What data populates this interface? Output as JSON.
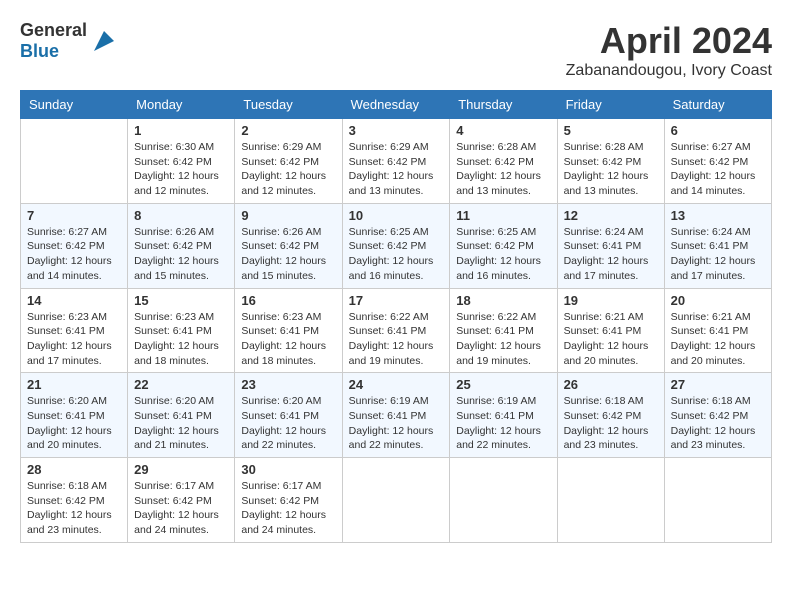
{
  "header": {
    "logo_general": "General",
    "logo_blue": "Blue",
    "month_year": "April 2024",
    "location": "Zabanandougou, Ivory Coast"
  },
  "calendar": {
    "headers": [
      "Sunday",
      "Monday",
      "Tuesday",
      "Wednesday",
      "Thursday",
      "Friday",
      "Saturday"
    ],
    "weeks": [
      [
        {
          "day": "",
          "sunrise": "",
          "sunset": "",
          "daylight": ""
        },
        {
          "day": "1",
          "sunrise": "Sunrise: 6:30 AM",
          "sunset": "Sunset: 6:42 PM",
          "daylight": "Daylight: 12 hours and 12 minutes."
        },
        {
          "day": "2",
          "sunrise": "Sunrise: 6:29 AM",
          "sunset": "Sunset: 6:42 PM",
          "daylight": "Daylight: 12 hours and 12 minutes."
        },
        {
          "day": "3",
          "sunrise": "Sunrise: 6:29 AM",
          "sunset": "Sunset: 6:42 PM",
          "daylight": "Daylight: 12 hours and 13 minutes."
        },
        {
          "day": "4",
          "sunrise": "Sunrise: 6:28 AM",
          "sunset": "Sunset: 6:42 PM",
          "daylight": "Daylight: 12 hours and 13 minutes."
        },
        {
          "day": "5",
          "sunrise": "Sunrise: 6:28 AM",
          "sunset": "Sunset: 6:42 PM",
          "daylight": "Daylight: 12 hours and 13 minutes."
        },
        {
          "day": "6",
          "sunrise": "Sunrise: 6:27 AM",
          "sunset": "Sunset: 6:42 PM",
          "daylight": "Daylight: 12 hours and 14 minutes."
        }
      ],
      [
        {
          "day": "7",
          "sunrise": "Sunrise: 6:27 AM",
          "sunset": "Sunset: 6:42 PM",
          "daylight": "Daylight: 12 hours and 14 minutes."
        },
        {
          "day": "8",
          "sunrise": "Sunrise: 6:26 AM",
          "sunset": "Sunset: 6:42 PM",
          "daylight": "Daylight: 12 hours and 15 minutes."
        },
        {
          "day": "9",
          "sunrise": "Sunrise: 6:26 AM",
          "sunset": "Sunset: 6:42 PM",
          "daylight": "Daylight: 12 hours and 15 minutes."
        },
        {
          "day": "10",
          "sunrise": "Sunrise: 6:25 AM",
          "sunset": "Sunset: 6:42 PM",
          "daylight": "Daylight: 12 hours and 16 minutes."
        },
        {
          "day": "11",
          "sunrise": "Sunrise: 6:25 AM",
          "sunset": "Sunset: 6:42 PM",
          "daylight": "Daylight: 12 hours and 16 minutes."
        },
        {
          "day": "12",
          "sunrise": "Sunrise: 6:24 AM",
          "sunset": "Sunset: 6:41 PM",
          "daylight": "Daylight: 12 hours and 17 minutes."
        },
        {
          "day": "13",
          "sunrise": "Sunrise: 6:24 AM",
          "sunset": "Sunset: 6:41 PM",
          "daylight": "Daylight: 12 hours and 17 minutes."
        }
      ],
      [
        {
          "day": "14",
          "sunrise": "Sunrise: 6:23 AM",
          "sunset": "Sunset: 6:41 PM",
          "daylight": "Daylight: 12 hours and 17 minutes."
        },
        {
          "day": "15",
          "sunrise": "Sunrise: 6:23 AM",
          "sunset": "Sunset: 6:41 PM",
          "daylight": "Daylight: 12 hours and 18 minutes."
        },
        {
          "day": "16",
          "sunrise": "Sunrise: 6:23 AM",
          "sunset": "Sunset: 6:41 PM",
          "daylight": "Daylight: 12 hours and 18 minutes."
        },
        {
          "day": "17",
          "sunrise": "Sunrise: 6:22 AM",
          "sunset": "Sunset: 6:41 PM",
          "daylight": "Daylight: 12 hours and 19 minutes."
        },
        {
          "day": "18",
          "sunrise": "Sunrise: 6:22 AM",
          "sunset": "Sunset: 6:41 PM",
          "daylight": "Daylight: 12 hours and 19 minutes."
        },
        {
          "day": "19",
          "sunrise": "Sunrise: 6:21 AM",
          "sunset": "Sunset: 6:41 PM",
          "daylight": "Daylight: 12 hours and 20 minutes."
        },
        {
          "day": "20",
          "sunrise": "Sunrise: 6:21 AM",
          "sunset": "Sunset: 6:41 PM",
          "daylight": "Daylight: 12 hours and 20 minutes."
        }
      ],
      [
        {
          "day": "21",
          "sunrise": "Sunrise: 6:20 AM",
          "sunset": "Sunset: 6:41 PM",
          "daylight": "Daylight: 12 hours and 20 minutes."
        },
        {
          "day": "22",
          "sunrise": "Sunrise: 6:20 AM",
          "sunset": "Sunset: 6:41 PM",
          "daylight": "Daylight: 12 hours and 21 minutes."
        },
        {
          "day": "23",
          "sunrise": "Sunrise: 6:20 AM",
          "sunset": "Sunset: 6:41 PM",
          "daylight": "Daylight: 12 hours and 22 minutes."
        },
        {
          "day": "24",
          "sunrise": "Sunrise: 6:19 AM",
          "sunset": "Sunset: 6:41 PM",
          "daylight": "Daylight: 12 hours and 22 minutes."
        },
        {
          "day": "25",
          "sunrise": "Sunrise: 6:19 AM",
          "sunset": "Sunset: 6:41 PM",
          "daylight": "Daylight: 12 hours and 22 minutes."
        },
        {
          "day": "26",
          "sunrise": "Sunrise: 6:18 AM",
          "sunset": "Sunset: 6:42 PM",
          "daylight": "Daylight: 12 hours and 23 minutes."
        },
        {
          "day": "27",
          "sunrise": "Sunrise: 6:18 AM",
          "sunset": "Sunset: 6:42 PM",
          "daylight": "Daylight: 12 hours and 23 minutes."
        }
      ],
      [
        {
          "day": "28",
          "sunrise": "Sunrise: 6:18 AM",
          "sunset": "Sunset: 6:42 PM",
          "daylight": "Daylight: 12 hours and 23 minutes."
        },
        {
          "day": "29",
          "sunrise": "Sunrise: 6:17 AM",
          "sunset": "Sunset: 6:42 PM",
          "daylight": "Daylight: 12 hours and 24 minutes."
        },
        {
          "day": "30",
          "sunrise": "Sunrise: 6:17 AM",
          "sunset": "Sunset: 6:42 PM",
          "daylight": "Daylight: 12 hours and 24 minutes."
        },
        {
          "day": "",
          "sunrise": "",
          "sunset": "",
          "daylight": ""
        },
        {
          "day": "",
          "sunrise": "",
          "sunset": "",
          "daylight": ""
        },
        {
          "day": "",
          "sunrise": "",
          "sunset": "",
          "daylight": ""
        },
        {
          "day": "",
          "sunrise": "",
          "sunset": "",
          "daylight": ""
        }
      ]
    ]
  }
}
